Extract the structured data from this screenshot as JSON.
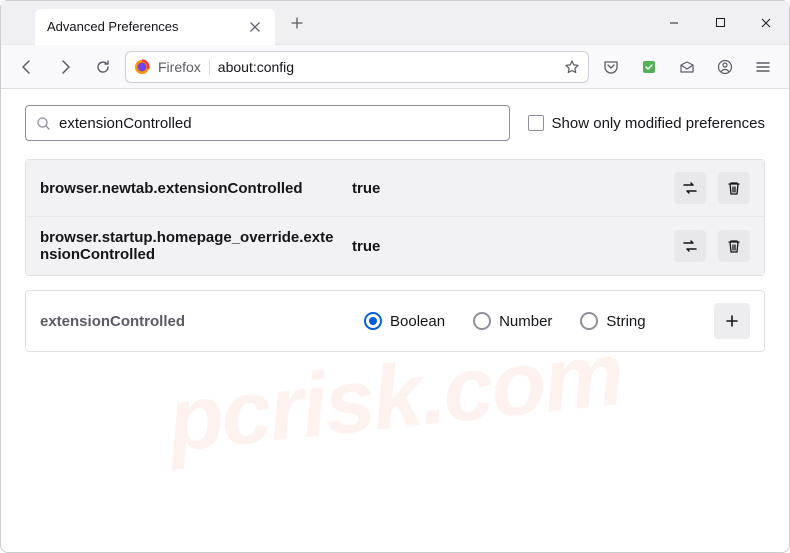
{
  "window": {
    "tab_title": "Advanced Preferences",
    "url_label": "Firefox",
    "url": "about:config"
  },
  "search": {
    "value": "extensionControlled",
    "checkbox_label": "Show only modified preferences"
  },
  "results": [
    {
      "name": "browser.newtab.extensionControlled",
      "value": "true"
    },
    {
      "name": "browser.startup.homepage_override.extensionControlled",
      "value": "true"
    }
  ],
  "new_pref": {
    "name": "extensionControlled",
    "types": [
      "Boolean",
      "Number",
      "String"
    ],
    "selected": "Boolean"
  },
  "watermark": "pcrisk.com"
}
